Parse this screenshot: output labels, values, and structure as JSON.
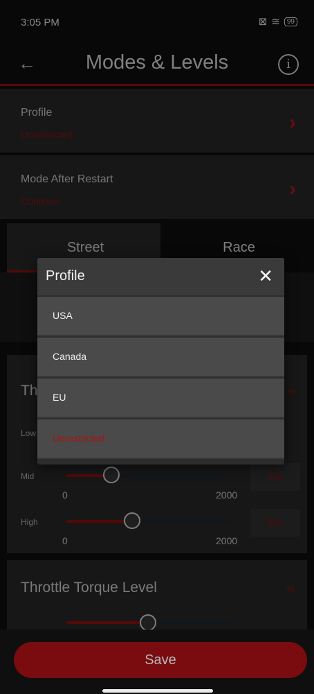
{
  "status_bar": {
    "time": "3:05 PM",
    "battery": "99"
  },
  "app_bar": {
    "back_icon": "arrow-left-icon",
    "title": "Modes & Levels",
    "info_icon": "info-icon"
  },
  "settings": [
    {
      "title": "Profile",
      "value": "Unrestricted"
    },
    {
      "title": "Mode After Restart",
      "value": "Continue"
    }
  ],
  "tabs": [
    {
      "label": "Street",
      "selected": true
    },
    {
      "label": "Race",
      "selected": false
    }
  ],
  "throttle_response": {
    "title_visible": "Th",
    "unit_visible": "w",
    "low_label": "Low",
    "mid": {
      "label": "Mid",
      "value": "550",
      "min": "0",
      "max": "2000",
      "level": 550
    },
    "high": {
      "label": "High",
      "value": "800",
      "min": "0",
      "max": "2000",
      "level": 800
    }
  },
  "throttle_torque": {
    "title": "Throttle Torque Level",
    "unit": "%"
  },
  "save_label": "Save",
  "dialog": {
    "title": "Profile",
    "close_icon": "close-icon",
    "options": [
      "USA",
      "Canada",
      "EU",
      "Unrestricted"
    ],
    "selected": "Unrestricted"
  },
  "colors": {
    "accent": "#9b1010",
    "background": "#0f0f0f",
    "card": "#2a2a2a"
  }
}
